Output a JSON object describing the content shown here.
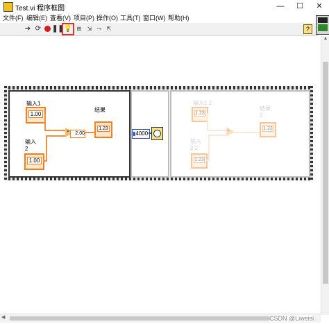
{
  "window": {
    "title": "Test.vi 程序框图",
    "minimize": "—",
    "maximize": "☐",
    "close": "✕"
  },
  "menu": [
    "文件(F)",
    "编辑(E)",
    "查看(V)",
    "项目(P)",
    "操作(O)",
    "工具(T)",
    "窗口(W)",
    "帮助(H)"
  ],
  "toolbar": {
    "icons": [
      "run-arrow-icon",
      "run-continuously-icon",
      "abort-icon",
      "pause-icon",
      "highlight-execution-icon",
      "retain-wire-values-icon",
      "step-into-icon",
      "step-over-icon",
      "step-out-icon",
      "help-icon"
    ],
    "help_label": "?"
  },
  "frame1": {
    "input1_label": "输入1",
    "input1_value": "1.00",
    "input2_label": "输入\n2",
    "input2_value": "1.00",
    "add_symbol": ">",
    "sum_value": "2.00",
    "result_label": "结果",
    "result_indicator": "1.23"
  },
  "frame2": {
    "wait_value": "4000"
  },
  "frame3": {
    "input1_label": "输入1 2",
    "input2_label": "输入\n2 2",
    "result_label": "结果\n2",
    "indicator": "1.23",
    "add_symbol": "+"
  },
  "watermark": "CSDN @Liweisi",
  "colors": {
    "accent_highlight": "#e03030",
    "wire_orange": "#f08020",
    "frame_border": "#333333"
  }
}
